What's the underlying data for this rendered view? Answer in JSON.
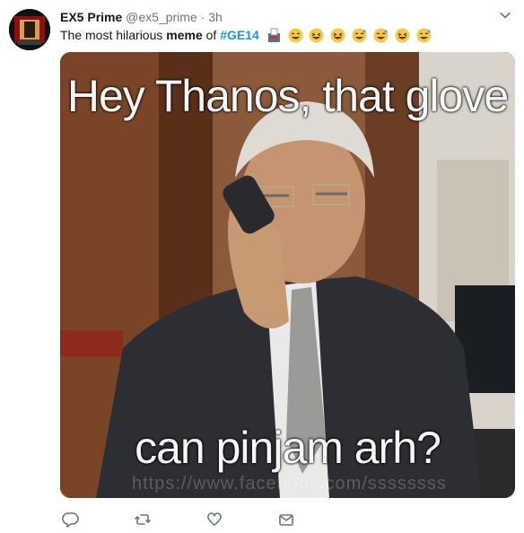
{
  "tweet": {
    "display_name": "EX5 Prime",
    "handle": "@ex5_prime",
    "separator": "·",
    "time": "3h",
    "text_prefix": "The most hilarious ",
    "text_bold": "meme",
    "text_middle": " of ",
    "hashtag": "#GE14"
  },
  "media": {
    "caption_top": "Hey Thanos, that glove",
    "caption_bottom": "can pinjam arh?",
    "watermark": "https://www.facebook.com/ssssssss"
  },
  "icons": {
    "more": "chevron-down-icon",
    "reply": "reply-icon",
    "retweet": "retweet-icon",
    "like": "heart-icon",
    "dm": "envelope-icon"
  },
  "colors": {
    "link": "#1b95e0",
    "secondary_text": "#657786",
    "icon": "#657786"
  }
}
